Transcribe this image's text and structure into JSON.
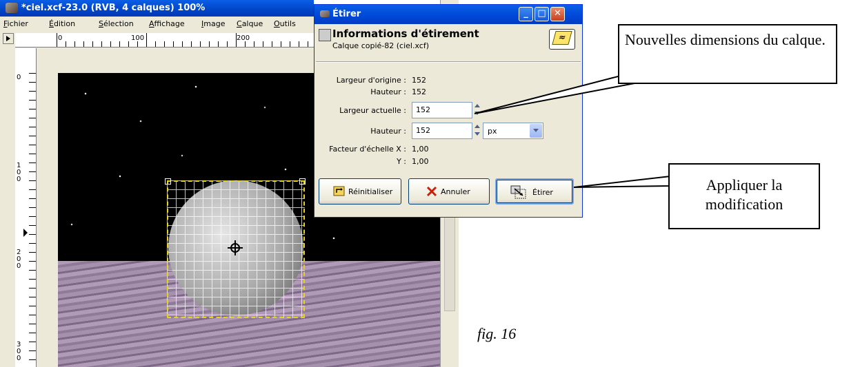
{
  "gimp_window": {
    "title": "*ciel.xcf-23.0 (RVB, 4 calques) 100%",
    "menu": [
      "Fichier",
      "Édition",
      "Sélection",
      "Affichage",
      "Image",
      "Calque",
      "Outils"
    ],
    "hruler_labels": [
      "0",
      "100",
      "200"
    ],
    "vruler_labels": [
      "0",
      "1\n0\n0",
      "2\n0\n0",
      "3\n0\n0"
    ]
  },
  "dialog": {
    "title": "Étirer",
    "header_title": "Informations d'étirement",
    "header_subtitle": "Calque copié-82 (ciel.xcf)",
    "orig_width_label": "Largeur d'origine :",
    "orig_width_value": "152",
    "orig_height_label": "Hauteur :",
    "orig_height_value": "152",
    "cur_width_label": "Largeur actuelle :",
    "cur_width_value": "152",
    "cur_height_label": "Hauteur :",
    "cur_height_value": "152",
    "unit": "px",
    "scale_x_label": "Facteur d'échelle X :",
    "scale_x_value": "1,00",
    "scale_y_label": "Y :",
    "scale_y_value": "1,00",
    "buttons": {
      "reset": "Réinitialiser",
      "cancel": "Annuler",
      "stretch": "Étirer"
    }
  },
  "callouts": {
    "dimensions": "Nouvelles dimensions du calque.",
    "apply": "Appliquer la modification"
  },
  "figure_label": "fig. 16"
}
